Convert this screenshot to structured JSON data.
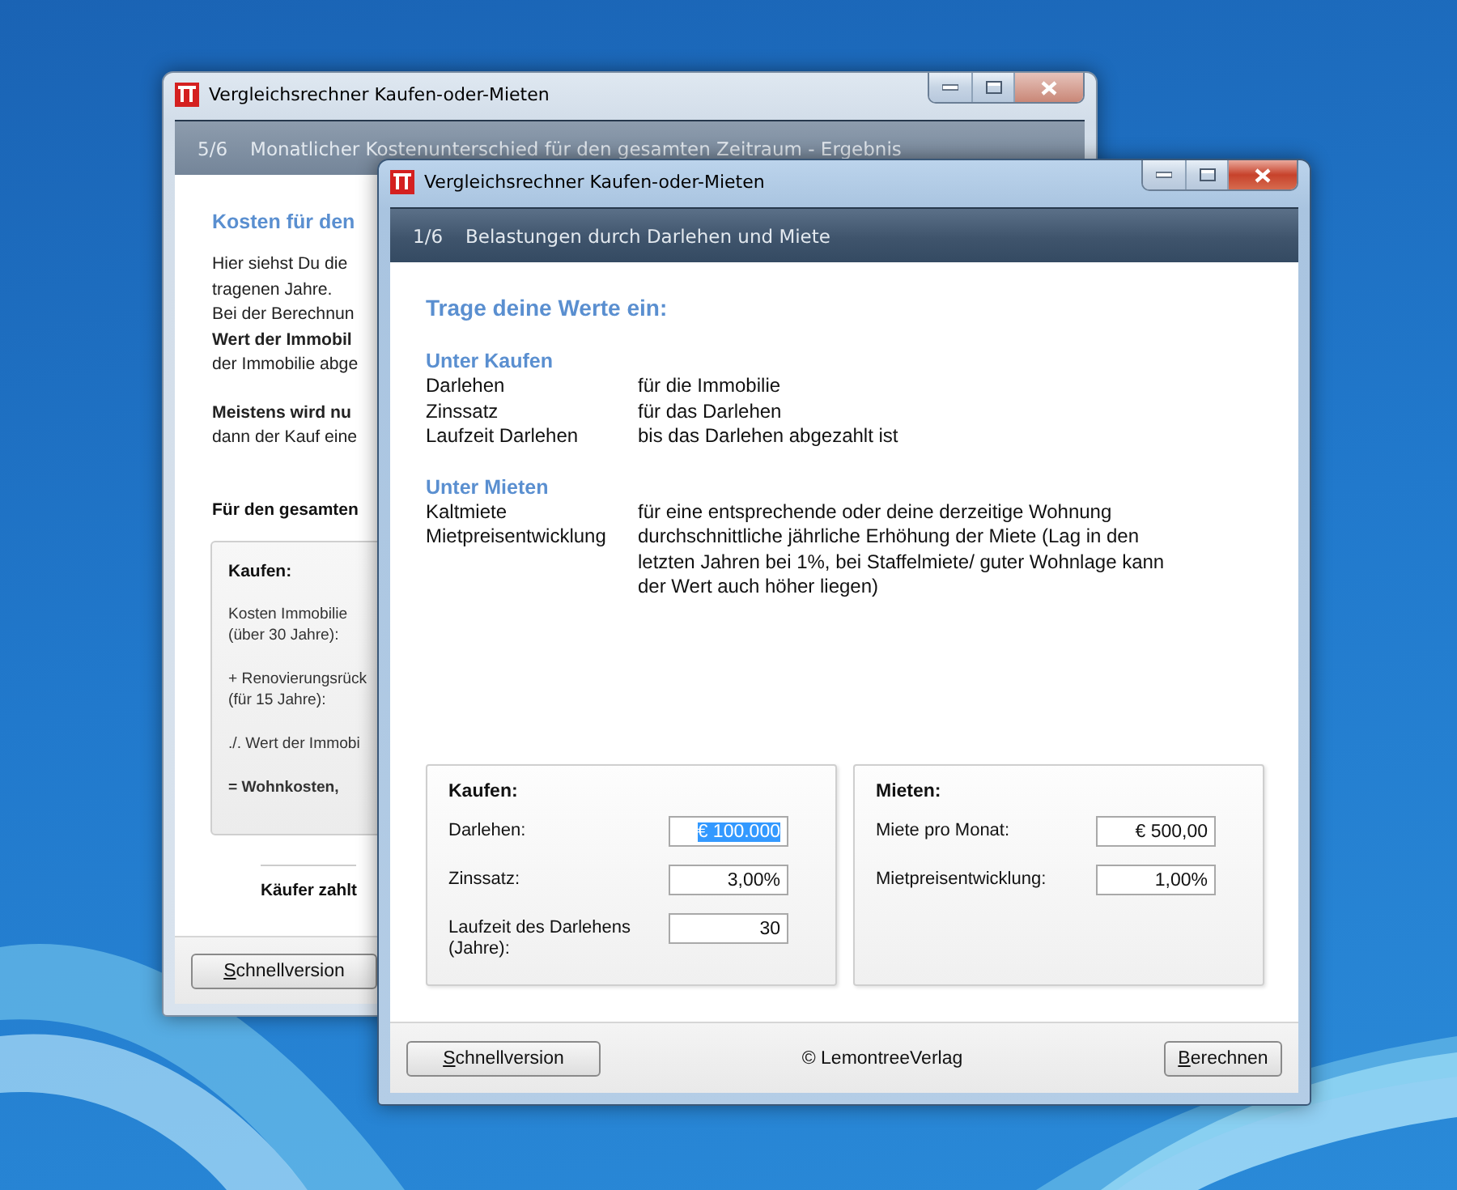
{
  "back_window": {
    "title": "Vergleichsrechner Kaufen-oder-Mieten",
    "active": false,
    "step": "5/6",
    "step_title": "Monatlicher Kostenunterschied für den gesamten Zeitraum - Ergebnis",
    "content_title": "Kosten für den",
    "paragraphs": [
      {
        "lines": [
          {
            "text": "Hier siehst Du die",
            "bold": false
          },
          {
            "text": "tragenen Jahre.",
            "bold": false
          },
          {
            "text": "Bei der Berechnun",
            "bold": false
          },
          {
            "text": "Wert der Immobil",
            "bold": true
          },
          {
            "text": "der Immobilie abge",
            "bold": false
          }
        ]
      },
      {
        "lines": [
          {
            "text": "Meistens wird nu",
            "bold": true
          },
          {
            "text": "dann der Kauf eine",
            "bold": false
          }
        ]
      }
    ],
    "section_label": "Für den gesamten",
    "box": {
      "title": "Kaufen:",
      "rows": [
        {
          "lines": [
            "Kosten Immobilie",
            "(über 30 Jahre):"
          ],
          "bold": false
        },
        {
          "lines": [
            "+ Renovierungsrück",
            "(für 15 Jahre):"
          ],
          "bold": false
        },
        {
          "lines": [
            "./. Wert der Immobi"
          ],
          "bold": false
        },
        {
          "lines": [
            "= Wohnkosten,"
          ],
          "bold": true
        }
      ]
    },
    "summary": "Käufer zahlt",
    "button": "Schnellversion"
  },
  "front_window": {
    "title": "Vergleichsrechner Kaufen-oder-Mieten",
    "active": true,
    "step": "1/6",
    "step_title": "Belastungen durch Darlehen und Miete",
    "intro_title": "Trage deine Werte ein:",
    "sections": [
      {
        "heading": "Unter Kaufen",
        "items": [
          {
            "term": "Darlehen",
            "description": "für die Immobilie"
          },
          {
            "term": "Zinssatz",
            "description": "für das Darlehen"
          },
          {
            "term": "Laufzeit Darlehen",
            "description": "bis das Darlehen abgezahlt ist"
          }
        ]
      },
      {
        "heading": "Unter Mieten",
        "items": [
          {
            "term": "Kaltmiete",
            "description": "für eine entsprechende oder deine derzeitige Wohnung"
          },
          {
            "term": "Mietpreisentwicklung",
            "description": "durchschnittliche jährliche Erhöhung der Miete (Lag in den letzten Jahren bei 1%, bei Staffelmiete/ guter Wohnlage kann der Wert auch höher liegen)"
          }
        ]
      }
    ],
    "panels": [
      {
        "title": "Kaufen:",
        "fields": [
          {
            "label": "Darlehen:",
            "value": "€ 100.000",
            "selected": true
          },
          {
            "label": "Zinssatz:",
            "value": "3,00%",
            "selected": false
          },
          {
            "label": "Laufzeit des Darlehens (Jahre):",
            "value": "30",
            "selected": false
          }
        ]
      },
      {
        "title": "Mieten:",
        "fields": [
          {
            "label": "Miete pro Monat:",
            "value": "€ 500,00",
            "selected": false
          },
          {
            "label": "Mietpreisentwicklung:",
            "value": "1,00%",
            "selected": false
          }
        ]
      }
    ],
    "footer": {
      "left_button": "Schnellversion",
      "copyright": "© LemontreeVerlag",
      "right_button": "Berechnen"
    }
  }
}
